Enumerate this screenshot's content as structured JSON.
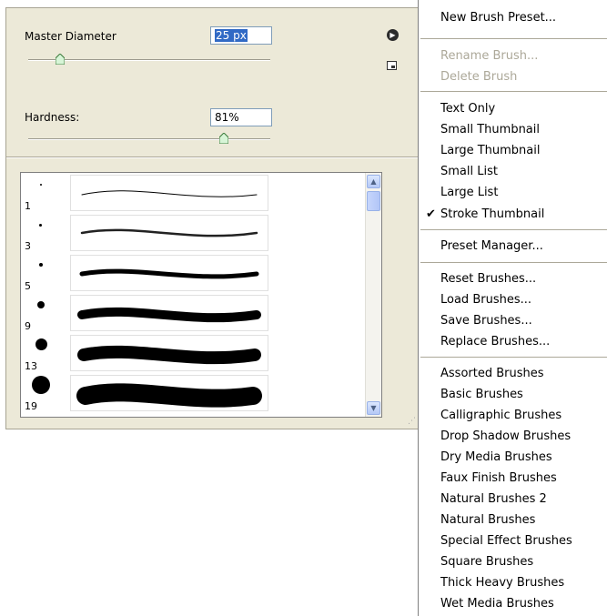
{
  "panel": {
    "master_diameter_label": "Master Diameter",
    "master_diameter_value": "25 px",
    "hardness_label": "Hardness:",
    "hardness_value": "81%",
    "diameter_slider_level": 0.13,
    "hardness_slider_level": 0.81
  },
  "brushes": [
    {
      "size": "1"
    },
    {
      "size": "3"
    },
    {
      "size": "5"
    },
    {
      "size": "9"
    },
    {
      "size": "13"
    },
    {
      "size": "19"
    }
  ],
  "icons": {
    "flyout": "flyout-arrow-icon",
    "new_preset": "new-preset-icon",
    "scroll_up": "scroll-up-icon",
    "scroll_down": "scroll-down-icon",
    "check": "checkmark-icon"
  },
  "menu": {
    "new_brush_preset": "New Brush Preset...",
    "rename_brush": "Rename Brush...",
    "delete_brush": "Delete Brush",
    "text_only": "Text Only",
    "small_thumbnail": "Small Thumbnail",
    "large_thumbnail": "Large Thumbnail",
    "small_list": "Small List",
    "large_list": "Large List",
    "stroke_thumbnail": "Stroke Thumbnail",
    "preset_manager": "Preset Manager...",
    "reset_brushes": "Reset Brushes...",
    "load_brushes": "Load Brushes...",
    "save_brushes": "Save Brushes...",
    "replace_brushes": "Replace Brushes...",
    "libraries": [
      "Assorted Brushes",
      "Basic Brushes",
      "Calligraphic Brushes",
      "Drop Shadow Brushes",
      "Dry Media Brushes",
      "Faux Finish Brushes",
      "Natural Brushes 2",
      "Natural Brushes",
      "Special Effect Brushes",
      "Square Brushes",
      "Thick Heavy Brushes",
      "Wet Media Brushes"
    ]
  },
  "colors": {
    "panel_bg": "#ece9d8",
    "selection": "#316ac5",
    "disabled_text": "#aca899"
  }
}
